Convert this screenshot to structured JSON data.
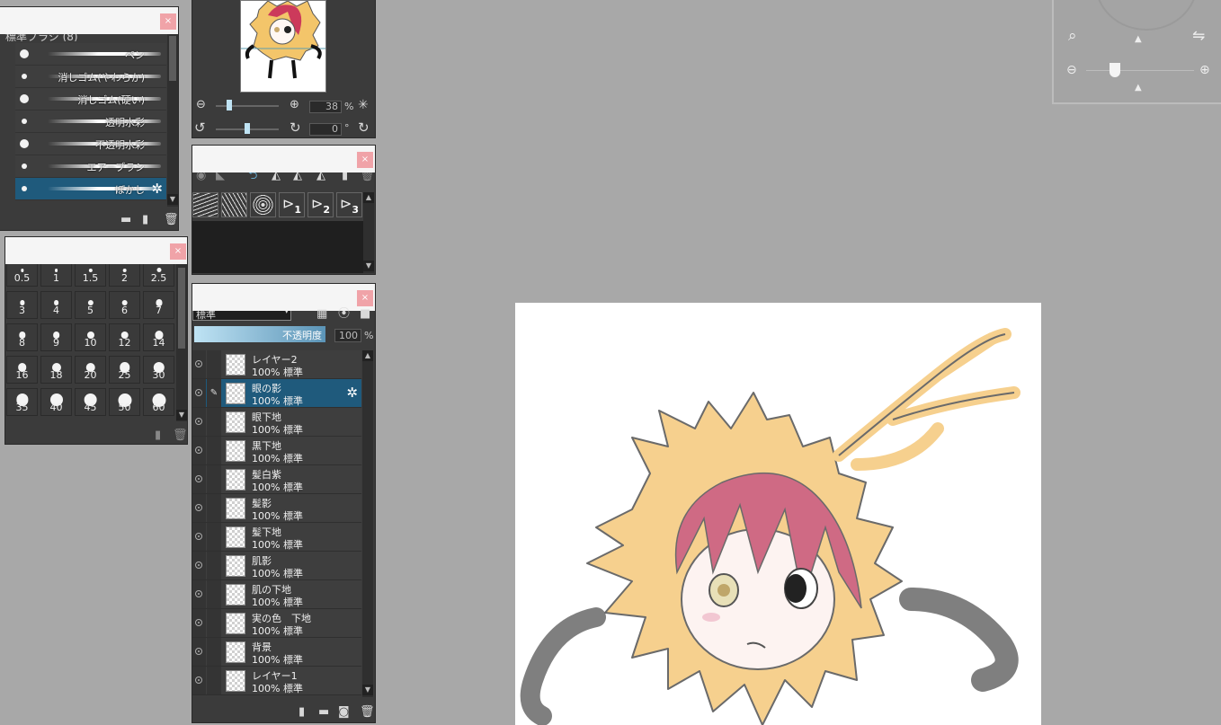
{
  "brush_panel": {
    "close_label": "×",
    "group_title": "標準ブラシ (8)",
    "brushes": [
      {
        "name": "ペン",
        "dot": "large"
      },
      {
        "name": "消しゴム(やわらか)",
        "dot": "small"
      },
      {
        "name": "消しゴム(硬い)",
        "dot": "large"
      },
      {
        "name": "透明水彩",
        "dot": "small"
      },
      {
        "name": "不透明水彩",
        "dot": "large"
      },
      {
        "name": "エアーブラシ",
        "dot": "small"
      },
      {
        "name": "ぼかし",
        "dot": "small",
        "selected": true
      }
    ]
  },
  "size_panel": {
    "close_label": "×",
    "sizes": [
      "0.5",
      "1",
      "1.5",
      "2",
      "2.5",
      "3",
      "4",
      "5",
      "6",
      "7",
      "8",
      "9",
      "10",
      "12",
      "14",
      "16",
      "18",
      "20",
      "25",
      "30",
      "35",
      "40",
      "45",
      "50",
      "60"
    ]
  },
  "navigator_panel": {
    "zoom_value": "38",
    "zoom_unit": "%",
    "rotate_value": "0",
    "rotate_unit": "°"
  },
  "ruler_panel": {
    "close_label": "×",
    "subscripts": [
      "1",
      "2",
      "3"
    ]
  },
  "layer_panel": {
    "close_label": "×",
    "blend_mode": "標準",
    "opacity_label": "不透明度",
    "opacity_value": "100",
    "opacity_unit": "%",
    "layers": [
      {
        "name": "レイヤー2",
        "meta": "100% 標準"
      },
      {
        "name": "眼の影",
        "meta": "100% 標準",
        "selected": true
      },
      {
        "name": "眼下地",
        "meta": "100% 標準"
      },
      {
        "name": "黒下地",
        "meta": "100% 標準"
      },
      {
        "name": "髪白紫",
        "meta": "100% 標準"
      },
      {
        "name": "髪影",
        "meta": "100% 標準"
      },
      {
        "name": "髪下地",
        "meta": "100% 標準"
      },
      {
        "name": "肌影",
        "meta": "100% 標準"
      },
      {
        "name": "肌の下地",
        "meta": "100% 標準"
      },
      {
        "name": "実の色　下地",
        "meta": "100% 標準"
      },
      {
        "name": "背景",
        "meta": "100% 標準"
      },
      {
        "name": "レイヤー1",
        "meta": "100% 標準"
      }
    ]
  },
  "colors": {
    "accent": "#1f5a7c",
    "close": "#f0a3a8",
    "canvas_bg": "#a8a8a8"
  }
}
